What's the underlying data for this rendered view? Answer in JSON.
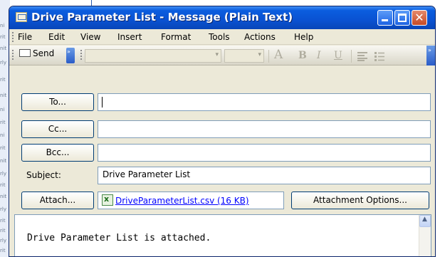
{
  "window": {
    "title": "Drive Parameter List - Message (Plain Text)",
    "close_glyph": "✕",
    "colors": {
      "titlebar": "#0a52d2",
      "link": "#0000ff"
    }
  },
  "menu": {
    "items": [
      {
        "label": "File",
        "mnemonic": "F"
      },
      {
        "label": "Edit",
        "mnemonic": "E"
      },
      {
        "label": "View",
        "mnemonic": "V"
      },
      {
        "label": "Insert",
        "mnemonic": "I"
      },
      {
        "label": "Format",
        "mnemonic": "o"
      },
      {
        "label": "Tools",
        "mnemonic": "T"
      },
      {
        "label": "Actions",
        "mnemonic": "A"
      },
      {
        "label": "Help",
        "mnemonic": "H"
      }
    ]
  },
  "toolbar": {
    "send_label": "Send",
    "more_glyph": "»",
    "combo_arrow": "▾",
    "format_buttons": [
      "A",
      "B",
      "I",
      "U"
    ],
    "icons": [
      "send-icon",
      "font-color-icon",
      "bold-icon",
      "italic-icon",
      "underline-icon",
      "align-left-icon",
      "bullets-icon"
    ]
  },
  "fields": {
    "to_button": "To...",
    "to_value": "",
    "cc_button": "Cc...",
    "cc_value": "",
    "bcc_button": "Bcc...",
    "bcc_value": "",
    "subject_label": "Subject:",
    "subject_value": "Drive Parameter List",
    "attach_button": "Attach...",
    "attachment_name": "DriveParameterList.csv (16 KB)",
    "attachment_options_button": "Attachment Options..."
  },
  "message": {
    "body_text": "Drive Parameter List is attached."
  },
  "scrollbar": {
    "up_glyph": "▲"
  },
  "background_window": {
    "fragments": [
      "ni",
      "rit",
      "nit",
      "rly",
      "rit",
      "nit",
      "ni",
      "rit",
      "ni",
      "rit",
      "nit",
      "rly",
      "rit",
      "nit",
      "rly",
      "rit",
      "rit",
      "rly",
      "rit"
    ]
  }
}
